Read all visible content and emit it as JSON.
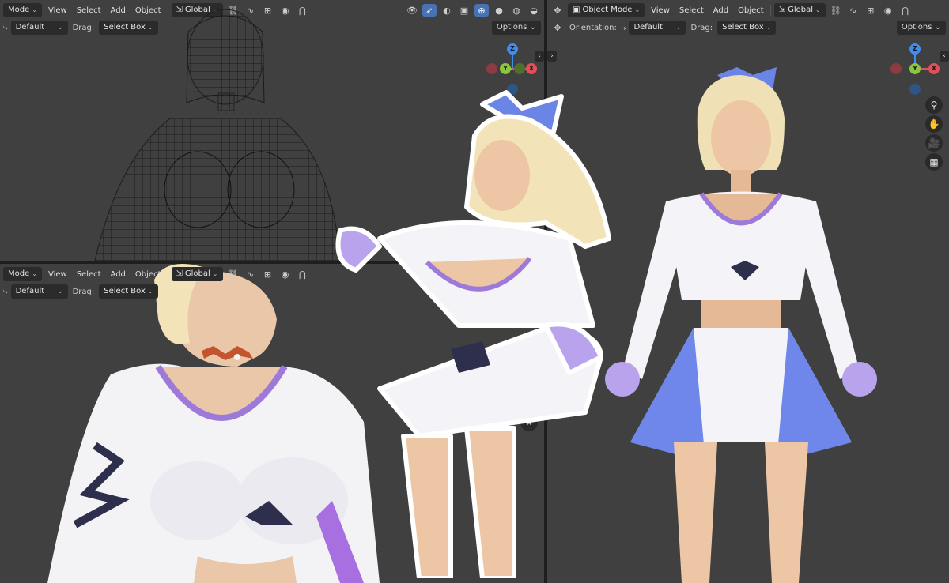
{
  "viewport_left_top": {
    "header": {
      "mode_label": "Mode",
      "menu": [
        "View",
        "Select",
        "Add",
        "Object"
      ],
      "transform_orientation": "Global",
      "orientation_value": "Default",
      "drag_label": "Drag:",
      "drag_value": "Select Box",
      "options_label": "Options"
    }
  },
  "viewport_left_bottom": {
    "header": {
      "mode_label": "Mode",
      "menu": [
        "View",
        "Select",
        "Add",
        "Object"
      ],
      "transform_orientation": "Global",
      "orientation_value": "Default",
      "drag_label": "Drag:",
      "drag_value": "Select Box"
    }
  },
  "viewport_right": {
    "header": {
      "mode_label": "Object Mode",
      "menu": [
        "View",
        "Select",
        "Add",
        "Object"
      ],
      "transform_orientation": "Global",
      "orientation_label": "Orientation:",
      "orientation_value": "Default",
      "drag_label": "Drag:",
      "drag_value": "Select Box",
      "options_label": "Options"
    }
  },
  "gizmo": {
    "x": "X",
    "y": "Y",
    "z": "Z"
  },
  "colors": {
    "viewport_bg": "#404040",
    "header_bg": "#3d3d3d",
    "accent": "#4772b3",
    "axis_x": "#e0505a",
    "axis_y": "#8cc63f",
    "axis_z": "#3d8ef0"
  },
  "icons": [
    "zoom-icon",
    "pan-hand-icon",
    "camera-icon",
    "grid-icon",
    "perspective-icon"
  ]
}
